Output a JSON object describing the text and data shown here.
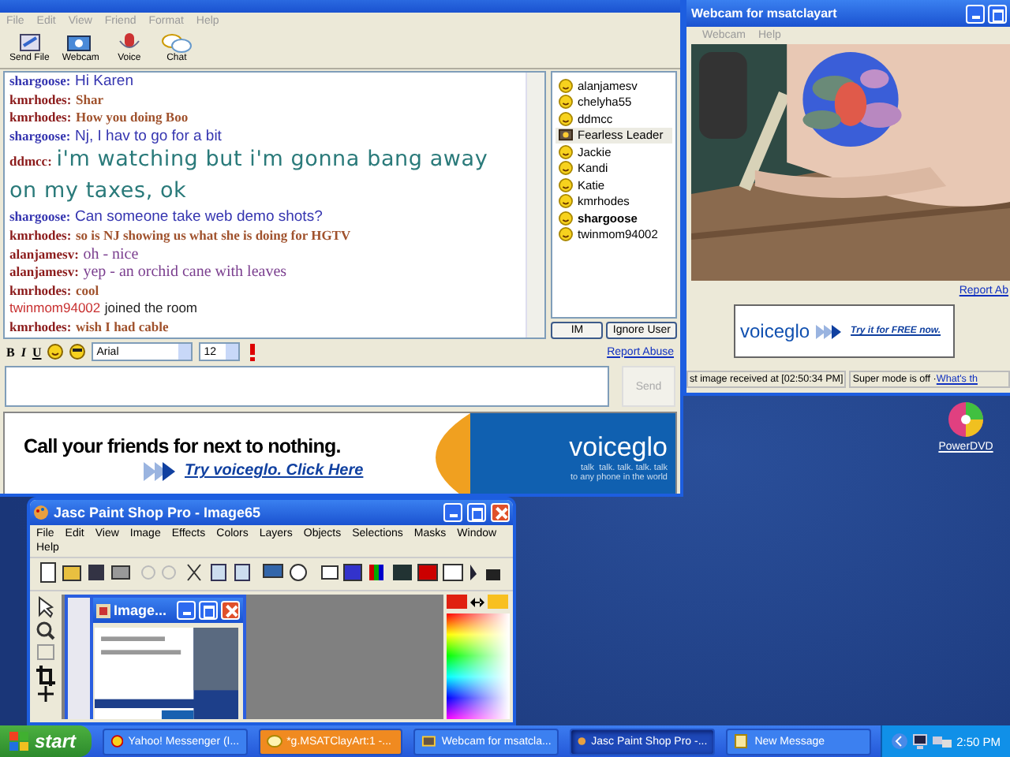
{
  "chat_window": {
    "menu": [
      "File",
      "Edit",
      "View",
      "Friend",
      "Format",
      "Help"
    ],
    "toolbar": [
      {
        "label": "Send File",
        "kind": "file"
      },
      {
        "label": "Webcam",
        "kind": "webcam"
      },
      {
        "label": "Voice",
        "kind": "voice"
      },
      {
        "label": "Chat",
        "kind": "chat"
      }
    ],
    "messages": [
      {
        "sender": "shargoose:",
        "text": "Hi Karen",
        "kind": "sans",
        "color": "#3535b0"
      },
      {
        "sender": "kmrhodes:",
        "text": "Shar",
        "kind": "bold",
        "color": "#a0522d"
      },
      {
        "sender": "kmrhodes:",
        "text": "How you doing Boo",
        "kind": "bold",
        "color": "#a0522d"
      },
      {
        "sender": "shargoose:",
        "text": "Nj, I hav to go for a bit",
        "kind": "sans",
        "color": "#3535b0"
      },
      {
        "sender": "ddmcc:",
        "text": "i'm watching but i'm gonna bang away on my taxes, ok",
        "kind": "big",
        "color": "#2a7a7a"
      },
      {
        "sender": "shargoose:",
        "text": "Can someone take web demo shots?",
        "kind": "sans",
        "color": "#3535b0"
      },
      {
        "sender": "kmrhodes:",
        "text": "so is NJ showing us what she is doing for HGTV",
        "kind": "bold",
        "color": "#a0522d"
      },
      {
        "sender": "alanjamesv:",
        "text": "oh - nice",
        "kind": "serif",
        "color": "#7b3f8f"
      },
      {
        "sender": "alanjamesv:",
        "text": "yep - an orchid cane with leaves",
        "kind": "serif",
        "color": "#7b3f8f"
      },
      {
        "sender": "kmrhodes:",
        "text": "cool",
        "kind": "bold",
        "color": "#a0522d"
      },
      {
        "sender": "twinmom94002",
        "text": "joined the room",
        "kind": "join",
        "color": "#c83030"
      },
      {
        "sender": "kmrhodes:",
        "text": "wish I had cable",
        "kind": "bold",
        "color": "#a0522d"
      }
    ],
    "users": [
      {
        "name": "alanjamesv",
        "kind": "smiley",
        "selected": false,
        "bold": false
      },
      {
        "name": "chelyha55",
        "kind": "smiley",
        "selected": false,
        "bold": false
      },
      {
        "name": "ddmcc",
        "kind": "smiley",
        "selected": false,
        "bold": false
      },
      {
        "name": "Fearless Leader",
        "kind": "webcam",
        "selected": true,
        "bold": false
      },
      {
        "name": "Jackie",
        "kind": "smiley",
        "selected": false,
        "bold": false
      },
      {
        "name": "Kandi",
        "kind": "smiley",
        "selected": false,
        "bold": false
      },
      {
        "name": "Katie",
        "kind": "smiley",
        "selected": false,
        "bold": false
      },
      {
        "name": "kmrhodes",
        "kind": "smiley",
        "selected": false,
        "bold": false
      },
      {
        "name": "shargoose",
        "kind": "smiley",
        "selected": false,
        "bold": true
      },
      {
        "name": "twinmom94002",
        "kind": "smiley",
        "selected": false,
        "bold": false
      }
    ],
    "buttons": [
      "IM",
      "Ignore User"
    ],
    "format_bar": {
      "styles": [
        "B",
        "I",
        "U"
      ],
      "font": "Arial",
      "size": "12"
    },
    "report_abuse": "Report Abuse",
    "send_button": "Send",
    "ad": {
      "headline": "Call your friends for next to nothing.",
      "link": "Try voiceglo. Click Here",
      "logo": "voiceglo",
      "tagline": [
        "talk  talk. talk. talk. talk",
        "to any phone in the world"
      ]
    }
  },
  "webcam_window": {
    "title": "Webcam for msatclayart",
    "menu": [
      "Webcam",
      "Help"
    ],
    "report_abuse": "Report Ab",
    "ad": {
      "logo": "voiceglo",
      "link": "Try it for FREE now."
    },
    "status_bar": {
      "received": "st image received at [02:50:34 PM]",
      "mode": "Super mode is off · ",
      "link": "What's th"
    }
  },
  "desktop_icons": [
    {
      "label": "PowerDVD"
    }
  ],
  "paint_window": {
    "title": "Jasc Paint Shop Pro - Image65",
    "menu": [
      "File",
      "Edit",
      "View",
      "Image",
      "Effects",
      "Colors",
      "Layers",
      "Objects",
      "Selections",
      "Masks",
      "Window",
      "Help"
    ],
    "image_window": {
      "title": "Image..."
    }
  },
  "taskbar": {
    "start": "start",
    "items": [
      {
        "label": "Yahoo! Messenger (I...",
        "kind": "messenger",
        "selected": false,
        "flashing": false
      },
      {
        "label": "*g.MSATClayArt:1 -...",
        "kind": "chat",
        "selected": false,
        "flashing": true
      },
      {
        "label": "Webcam for msatcla...",
        "kind": "webcam",
        "selected": false,
        "flashing": false
      },
      {
        "label": "Jasc Paint Shop Pro -...",
        "kind": "paint",
        "selected": true,
        "flashing": false
      },
      {
        "label": "New Message",
        "kind": "message",
        "selected": false,
        "flashing": false
      }
    ],
    "clock": "2:50 PM"
  }
}
